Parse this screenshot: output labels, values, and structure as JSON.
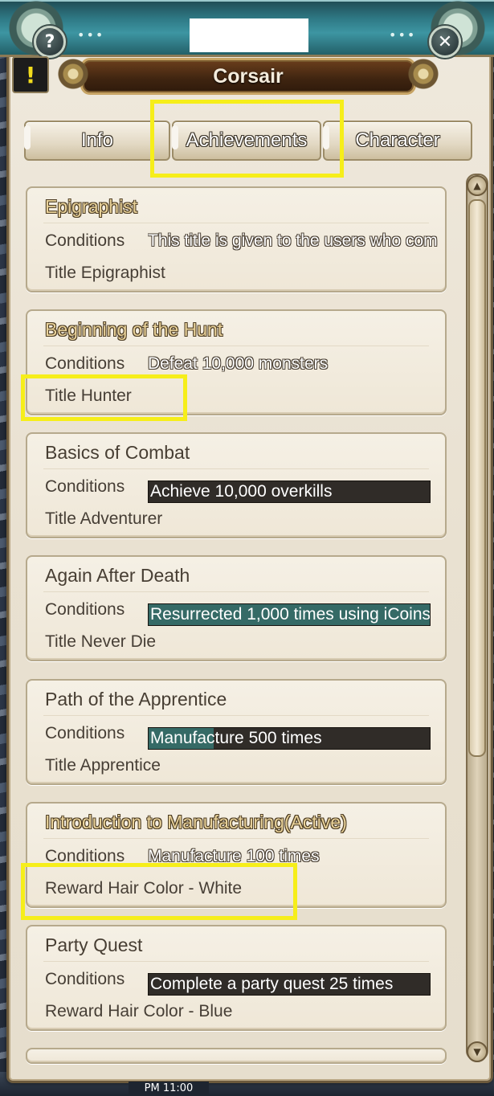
{
  "window": {
    "character_name": "Corsair",
    "help_label": "?",
    "close_label": "✕",
    "alert_label": "!",
    "title_dots_left": "•••",
    "title_dots_right": "•••"
  },
  "tabs": [
    {
      "label": "Info",
      "active": false
    },
    {
      "label": "Achievements",
      "active": true
    },
    {
      "label": "Character",
      "active": false
    }
  ],
  "achievements": [
    {
      "title": "Epigraphist",
      "conditions_label": "Conditions",
      "condition": "This title is given to the users who com",
      "condition_style": "plain",
      "reward": "Title Epigraphist",
      "title_style": "outlined"
    },
    {
      "title": "Beginning of the Hunt",
      "conditions_label": "Conditions",
      "condition": "Defeat 10,000 monsters",
      "condition_style": "plain",
      "reward": "Title Hunter",
      "title_style": "outlined"
    },
    {
      "title": "Basics of Combat",
      "conditions_label": "Conditions",
      "condition": "Achieve 10,000 overkills",
      "condition_style": "bar",
      "progress": 0,
      "reward": "Title Adventurer",
      "title_style": "plain"
    },
    {
      "title": "Again After Death",
      "conditions_label": "Conditions",
      "condition": "Resurrected 1,000 times using iCoins",
      "condition_style": "bar",
      "progress": 1.0,
      "reward": "Title Never Die",
      "title_style": "plain"
    },
    {
      "title": "Path of the Apprentice",
      "conditions_label": "Conditions",
      "condition": "Manufacture 500 times",
      "condition_style": "bar",
      "progress": 0.23,
      "reward": "Title Apprentice",
      "title_style": "plain"
    },
    {
      "title": "Introduction to Manufacturing(Active)",
      "conditions_label": "Conditions",
      "condition": "Manufacture 100 times",
      "condition_style": "plain",
      "reward": "Reward Hair Color - White",
      "title_style": "outlined"
    },
    {
      "title": "Party Quest",
      "conditions_label": "Conditions",
      "condition": "Complete a party quest 25 times",
      "condition_style": "bar",
      "progress": 0,
      "reward": "Reward Hair Color - Blue",
      "title_style": "plain"
    }
  ],
  "colors": {
    "highlight": "#f6ee1a",
    "progress_fill": "#356a66",
    "progress_bg": "#302c28"
  },
  "footer": {
    "clock": "PM 11:00"
  }
}
